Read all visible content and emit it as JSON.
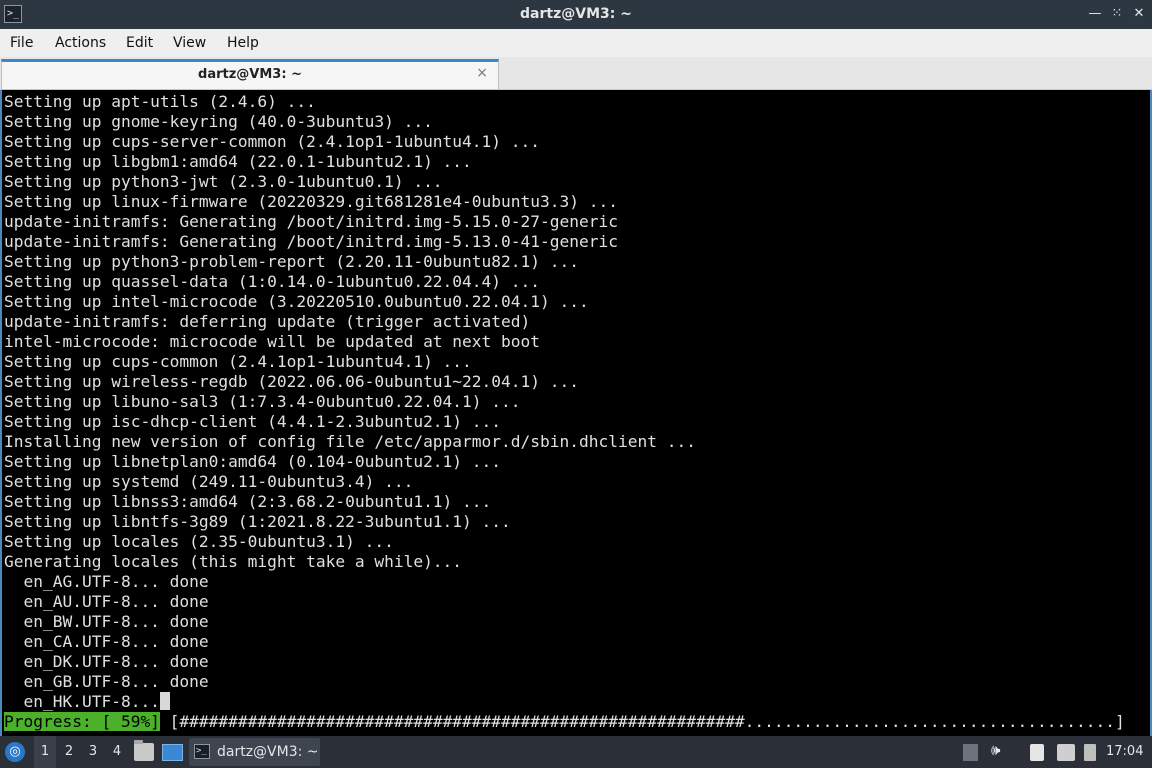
{
  "window": {
    "title": "dartz@VM3: ~",
    "app_icon": "terminal-icon",
    "controls": [
      "minimize-icon",
      "maximize-icon",
      "close-icon"
    ]
  },
  "menubar": {
    "items": [
      "File",
      "Actions",
      "Edit",
      "View",
      "Help"
    ]
  },
  "tabs": [
    {
      "label": "dartz@VM3: ~",
      "close": "×"
    }
  ],
  "terminal": {
    "lines": [
      "Setting up apt-utils (2.4.6) ...",
      "Setting up gnome-keyring (40.0-3ubuntu3) ...",
      "Setting up cups-server-common (2.4.1op1-1ubuntu4.1) ...",
      "Setting up libgbm1:amd64 (22.0.1-1ubuntu2.1) ...",
      "Setting up python3-jwt (2.3.0-1ubuntu0.1) ...",
      "Setting up linux-firmware (20220329.git681281e4-0ubuntu3.3) ...",
      "update-initramfs: Generating /boot/initrd.img-5.15.0-27-generic",
      "update-initramfs: Generating /boot/initrd.img-5.13.0-41-generic",
      "Setting up python3-problem-report (2.20.11-0ubuntu82.1) ...",
      "Setting up quassel-data (1:0.14.0-1ubuntu0.22.04.4) ...",
      "Setting up intel-microcode (3.20220510.0ubuntu0.22.04.1) ...",
      "update-initramfs: deferring update (trigger activated)",
      "intel-microcode: microcode will be updated at next boot",
      "Setting up cups-common (2.4.1op1-1ubuntu4.1) ...",
      "Setting up wireless-regdb (2022.06.06-0ubuntu1~22.04.1) ...",
      "Setting up libuno-sal3 (1:7.3.4-0ubuntu0.22.04.1) ...",
      "Setting up isc-dhcp-client (4.4.1-2.3ubuntu2.1) ...",
      "Installing new version of config file /etc/apparmor.d/sbin.dhclient ...",
      "Setting up libnetplan0:amd64 (0.104-0ubuntu2.1) ...",
      "Setting up systemd (249.11-0ubuntu3.4) ...",
      "Setting up libnss3:amd64 (2:3.68.2-0ubuntu1.1) ...",
      "Setting up libntfs-3g89 (1:2021.8.22-3ubuntu1.1) ...",
      "Setting up locales (2.35-0ubuntu3.1) ...",
      "Generating locales (this might take a while)...",
      "  en_AG.UTF-8... done",
      "  en_AU.UTF-8... done",
      "  en_BW.UTF-8... done",
      "  en_CA.UTF-8... done",
      "  en_DK.UTF-8... done",
      "  en_GB.UTF-8... done",
      "  en_HK.UTF-8..."
    ],
    "progress_label": "Progress: [ 59%]",
    "progress_bar": " [##########################################################......................................]",
    "progress_percent": 59
  },
  "taskbar": {
    "start_icon": "lubuntu-start-icon",
    "workspaces": [
      "1",
      "2",
      "3",
      "4"
    ],
    "active_workspace": "1",
    "launchers": [
      "file-manager-icon",
      "show-desktop-icon"
    ],
    "task_label": "dartz@VM3: ~",
    "tray_icons": [
      "tray-expand-icon",
      "volume-icon",
      "clipboard-icon",
      "network-icon",
      "battery-icon"
    ],
    "clock": "17:04"
  }
}
